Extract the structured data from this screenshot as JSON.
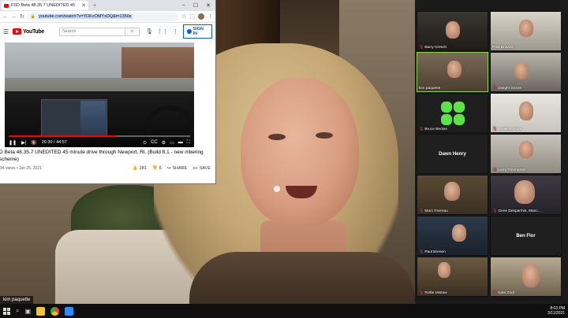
{
  "browser": {
    "tab_title": "FSD Beta 48.35.7 UNEDITED 45",
    "url": "youtube.com/watch?v=YDKzOMYxDQ&t=1350s",
    "icons": [
      "back-icon",
      "forward-icon",
      "reload-icon",
      "lock-icon",
      "star-icon",
      "extensions-icon",
      "menu-icon"
    ]
  },
  "youtube": {
    "logo_text": "YouTube",
    "search_placeholder": "Search",
    "signin_label": "SIGN IN",
    "player": {
      "time": "26:30 / 44:57",
      "progress": 0.59
    },
    "video_title": "D Beta 48.35.7 UNEDITED 45 minute drive through Newport, RI. (Build 8.1 - new mbering scheme)",
    "views_date": "94 views • Jan 26, 2021",
    "likes": "281",
    "dislikes": "6",
    "share_label": "SHARE",
    "save_label": "SAVE"
  },
  "main_speaker": {
    "name": "kim paquette"
  },
  "gallery": {
    "participants": [
      {
        "name": "Barry Kresch",
        "muted": true
      },
      {
        "name": "Paul Bravon",
        "muted": false
      },
      {
        "name": "kim paquette",
        "muted": false,
        "active": true
      },
      {
        "name": "Dwight Stover",
        "muted": true
      },
      {
        "name": "Bruce Becker",
        "muted": true
      },
      {
        "name": "Analiese Park",
        "muted": true
      },
      {
        "name": "Dawn Henry",
        "muted": false,
        "no_video": true
      },
      {
        "name": "Larry Thompson",
        "muted": true
      },
      {
        "name": "Marc Favreau",
        "muted": true
      },
      {
        "name": "Gene Desparmis, Manc...",
        "muted": true
      },
      {
        "name": "Paul Brenen",
        "muted": true
      },
      {
        "name": "Ben Flor",
        "muted": false,
        "no_video": true
      },
      {
        "name": "Rollie Mistaw",
        "muted": true
      },
      {
        "name": "Kate Zodl",
        "muted": true
      }
    ]
  },
  "taskbar": {
    "time": "8:03 PM",
    "date": "3/11/2021"
  }
}
